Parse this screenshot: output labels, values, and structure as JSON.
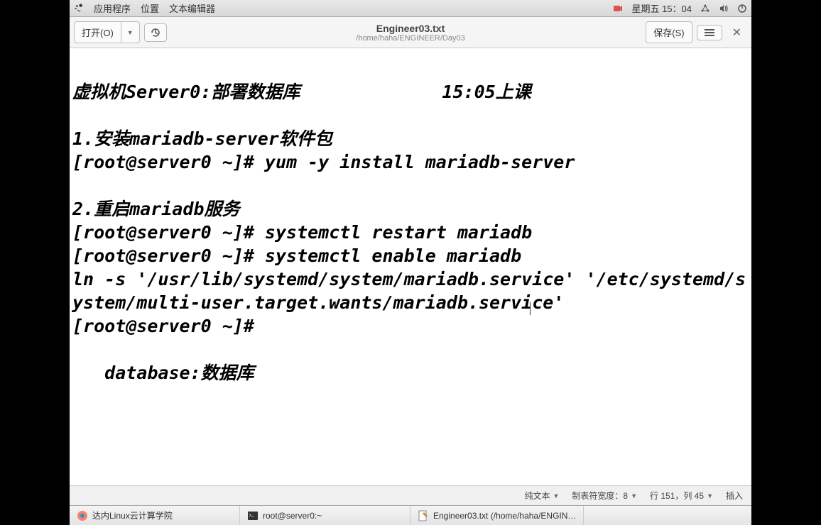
{
  "topbar": {
    "apps_label": "应用程序",
    "places_label": "位置",
    "editor_label": "文本编辑器",
    "datetime": "星期五 15：04"
  },
  "toolbar": {
    "open_label": "打开(O)",
    "save_label": "保存(S)",
    "filename": "Engineer03.txt",
    "filepath": "/home/haha/ENGINEER/Day03"
  },
  "editor": {
    "line1a": "虚拟机Server0:部署数据库",
    "line1b": "15:05上课",
    "line2": "1.安装mariadb-server软件包",
    "line3": "[root@server0 ~]# yum -y install mariadb-server",
    "line4": "",
    "line5": "2.重启mariadb服务",
    "line6": "[root@server0 ~]# systemctl restart mariadb",
    "line7": "[root@server0 ~]# systemctl enable mariadb",
    "line8": "ln -s '/usr/lib/systemd/system/mariadb.service' '/etc/systemd/system/multi-user.target.wants/mariadb.service'",
    "line9": "[root@server0 ~]# ",
    "line10": "",
    "line11": "   database:数据库"
  },
  "statusbar": {
    "syntax": "纯文本",
    "tabwidth": "制表符宽度：8",
    "position": "行 151，列 45",
    "mode": "插入"
  },
  "taskbar": {
    "item1": "达内Linux云计算学院",
    "item2": "root@server0:~",
    "item3": "Engineer03.txt (/home/haha/ENGIN…"
  }
}
